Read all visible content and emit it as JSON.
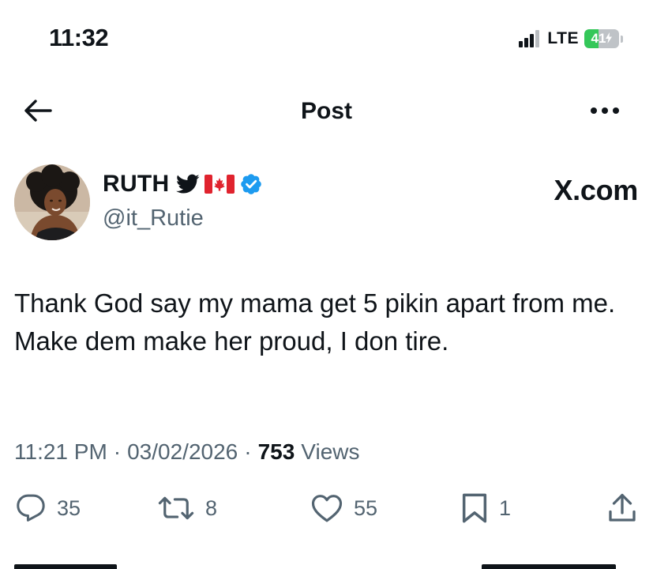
{
  "status_bar": {
    "time": "11:32",
    "network": "LTE",
    "battery": "41",
    "battery_level": 0.41
  },
  "nav": {
    "title": "Post",
    "back_icon": "arrow-left-icon",
    "more_icon": "more-horizontal-icon"
  },
  "author": {
    "name": "RUTH",
    "handle": "@it_Rutie",
    "badges": [
      "twitter-bird-icon",
      "canada-flag-icon",
      "verified-badge-icon"
    ],
    "watermark": "X.com"
  },
  "tweet": {
    "lines": [
      "Thank God say my mama get 5 pikin apart from me.",
      "Make dem make her proud, I don tire."
    ]
  },
  "meta": {
    "time": "11:21 PM",
    "date": "03/02/2026",
    "views_count": "753",
    "views_label": "Views"
  },
  "actions": {
    "replies": "35",
    "reposts": "8",
    "likes": "55",
    "bookmarks": "1"
  },
  "colors": {
    "text": "#0f1419",
    "muted": "#536471",
    "verified": "#1d9bf0",
    "battery": "#34c759"
  }
}
